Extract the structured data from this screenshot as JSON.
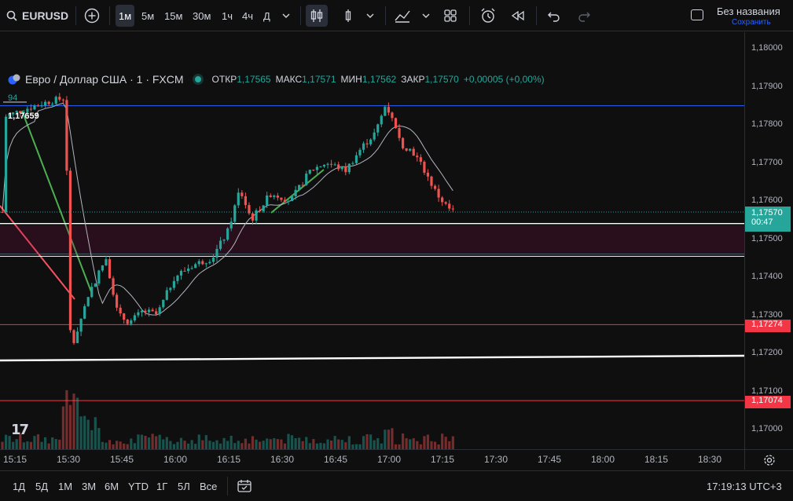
{
  "topbar": {
    "symbol": "EURUSD",
    "timeframes": [
      "1м",
      "5м",
      "15м",
      "30м",
      "1ч",
      "4ч",
      "Д"
    ],
    "active_timeframe": "1м",
    "layout_name": "Без названия",
    "layout_save": "Сохранить"
  },
  "legend": {
    "title": "Евро / Доллар США · 1 · FXCM",
    "open_label": "ОТКР",
    "open": "1,17565",
    "high_label": "МАКС",
    "high": "1,17571",
    "low_label": "МИН",
    "low": "1,17562",
    "close_label": "ЗАКР",
    "close": "1,17570",
    "change": "+0,00005 (+0,00%)",
    "volume": "94",
    "high_mark": "1,17659"
  },
  "price_axis": {
    "ticks": [
      "1,18000",
      "1,17900",
      "1,17800",
      "1,17700",
      "1,17600",
      "1,17500",
      "1,17400",
      "1,17300",
      "1,17200",
      "1,17100",
      "1,17000"
    ],
    "current_price": "1,17570",
    "countdown": "00:47",
    "level_1": "1,17274",
    "level_2": "1,17074"
  },
  "time_axis": {
    "ticks": [
      "15:15",
      "15:30",
      "15:45",
      "16:00",
      "16:15",
      "16:30",
      "16:45",
      "17:00",
      "17:15",
      "17:30",
      "17:45",
      "18:00",
      "18:15",
      "18:30"
    ]
  },
  "bottombar": {
    "ranges": [
      "1Д",
      "5Д",
      "1М",
      "3М",
      "6М",
      "YTD",
      "1Г",
      "5Л",
      "Все"
    ],
    "clock": "17:19:13 UTC+3"
  },
  "logo_text": "17",
  "colors": {
    "up": "#26a69a",
    "down": "#ef5350",
    "level_red": "#f23645",
    "line_blue": "#2962ff",
    "bg": "#0f0f0f"
  },
  "chart_data": {
    "type": "candlestick",
    "symbol": "EURUSD",
    "timeframe": "1м",
    "ylim": [
      1.1697,
      1.1803
    ],
    "x": [
      "15:15",
      "15:30",
      "15:45",
      "16:00",
      "16:15",
      "16:30",
      "16:45",
      "17:00",
      "17:15"
    ],
    "close_series": [
      1.1782,
      1.1786,
      1.173,
      1.1728,
      1.1745,
      1.1757,
      1.177,
      1.1778,
      1.1757
    ],
    "horizontal_levels": [
      1.17274,
      1.17074,
      1.1785,
      1.1754,
      1.1746
    ]
  }
}
